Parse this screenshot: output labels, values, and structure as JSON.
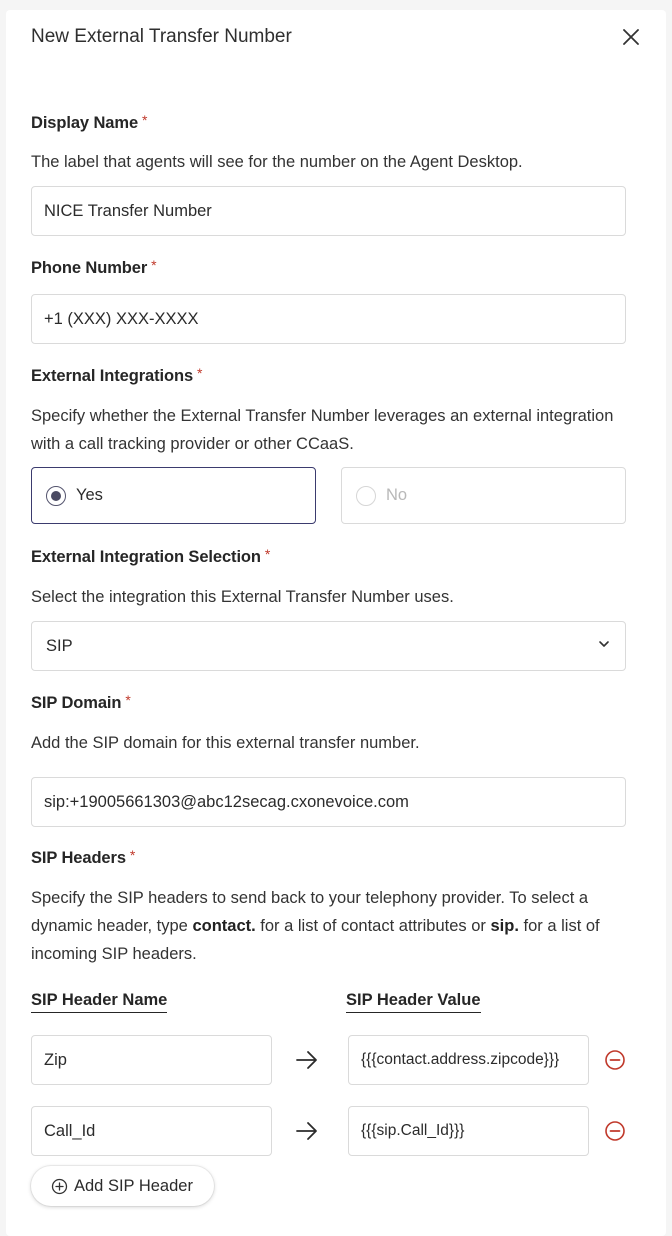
{
  "header": {
    "title": "New External Transfer Number",
    "close_icon": "close-icon"
  },
  "required_mark": "*",
  "display_name": {
    "label": "Display Name",
    "help": "The label that agents will see for the number on the Agent Desktop.",
    "value": "NICE Transfer Number"
  },
  "phone_number": {
    "label": "Phone Number",
    "value": "+1 (XXX) XXX-XXXX"
  },
  "external_integrations": {
    "label": "External Integrations",
    "help": "Specify whether the External Transfer Number leverages an external integration with a call tracking provider or other CCaaS.",
    "options": [
      {
        "label": "Yes",
        "selected": true
      },
      {
        "label": "No",
        "selected": false,
        "disabled": true
      }
    ]
  },
  "integration_selection": {
    "label": "External Integration Selection",
    "help": "Select the integration this External Transfer Number uses.",
    "value": "SIP",
    "icon": "chevron-down-icon"
  },
  "sip_domain": {
    "label": "SIP Domain",
    "help": "Add the SIP domain for this external transfer number.",
    "value": "sip:+19005661303@abc12secag.cxonevoice.com"
  },
  "sip_headers": {
    "label": "SIP Headers",
    "help_part1": "Specify the SIP headers to send back to your telephony provider. To select a dynamic header, type ",
    "help_bold1": "contact.",
    "help_part2": " for a list of contact attributes or ",
    "help_bold2": "sip.",
    "help_part3": " for a list of incoming SIP headers.",
    "col_name": "SIP Header Name",
    "col_value": "SIP Header Value",
    "rows": [
      {
        "name": "Zip",
        "value": "{{{contact.address.zipcode}}}"
      },
      {
        "name": "Call_Id",
        "value": "{{{sip.Call_Id}}}"
      }
    ],
    "add_label": "Add SIP Header"
  },
  "colors": {
    "accent": "#3b3b6e",
    "required": "#c0392b",
    "remove": "#c0392b"
  }
}
